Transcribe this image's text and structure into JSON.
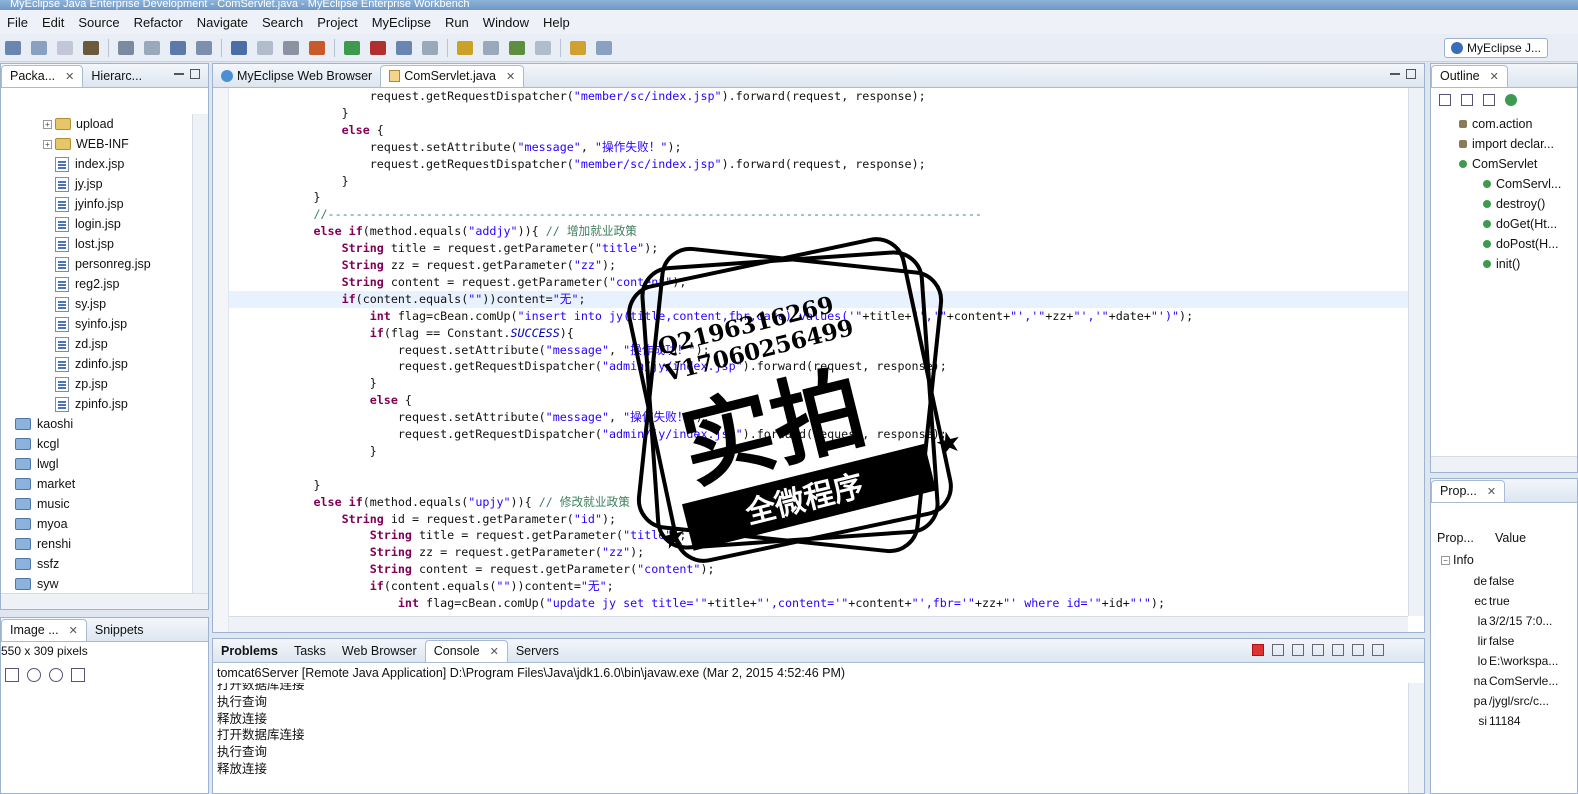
{
  "window": {
    "title": "MyEclipse Java Enterprise Development - ComServlet.java - MyEclipse Enterprise Workbench"
  },
  "menu": [
    "File",
    "Edit",
    "Source",
    "Refactor",
    "Navigate",
    "Search",
    "Project",
    "MyEclipse",
    "Run",
    "Window",
    "Help"
  ],
  "perspective": "MyEclipse J...",
  "left_panel": {
    "tabs": [
      "Packa...",
      "Hierarc..."
    ],
    "tree": [
      {
        "label": "upload",
        "type": "folder",
        "depth": 2,
        "expander": "+"
      },
      {
        "label": "WEB-INF",
        "type": "folder",
        "depth": 2,
        "expander": "+"
      },
      {
        "label": "index.jsp",
        "type": "jsp",
        "depth": 2
      },
      {
        "label": "jy.jsp",
        "type": "jsp",
        "depth": 2
      },
      {
        "label": "jyinfo.jsp",
        "type": "jsp",
        "depth": 2
      },
      {
        "label": "login.jsp",
        "type": "jsp",
        "depth": 2
      },
      {
        "label": "lost.jsp",
        "type": "jsp",
        "depth": 2
      },
      {
        "label": "personreg.jsp",
        "type": "jsp",
        "depth": 2
      },
      {
        "label": "reg2.jsp",
        "type": "jsp",
        "depth": 2
      },
      {
        "label": "sy.jsp",
        "type": "jsp",
        "depth": 2
      },
      {
        "label": "syinfo.jsp",
        "type": "jsp",
        "depth": 2
      },
      {
        "label": "zd.jsp",
        "type": "jsp",
        "depth": 2
      },
      {
        "label": "zdinfo.jsp",
        "type": "jsp",
        "depth": 2
      },
      {
        "label": "zp.jsp",
        "type": "jsp",
        "depth": 2
      },
      {
        "label": "zpinfo.jsp",
        "type": "jsp",
        "depth": 2
      },
      {
        "label": "kaoshi",
        "type": "proj",
        "depth": 1
      },
      {
        "label": "kcgl",
        "type": "proj",
        "depth": 1
      },
      {
        "label": "lwgl",
        "type": "proj",
        "depth": 1
      },
      {
        "label": "market",
        "type": "proj",
        "depth": 1
      },
      {
        "label": "music",
        "type": "proj",
        "depth": 1
      },
      {
        "label": "myoa",
        "type": "proj",
        "depth": 1
      },
      {
        "label": "renshi",
        "type": "proj",
        "depth": 1
      },
      {
        "label": "ssfz",
        "type": "proj",
        "depth": 1
      },
      {
        "label": "syw",
        "type": "proj",
        "depth": 1
      }
    ]
  },
  "image_panel": {
    "tabs": [
      "Image ...",
      "Snippets"
    ],
    "size_text": "550 x 309 pixels"
  },
  "editor": {
    "tabs": [
      "MyEclipse Web Browser",
      "ComServlet.java"
    ],
    "lines": [
      "                    request.getRequestDispatcher(\"member/sc/index.jsp\").forward(request, response);",
      "                }",
      "                else {",
      "                    request.setAttribute(\"message\", \"操作失败！\");",
      "                    request.getRequestDispatcher(\"member/sc/index.jsp\").forward(request, response);",
      "                }",
      "            }",
      "            //---------------------------------------------------------------------------------------------",
      "            else if(method.equals(\"addjy\")){ // 增加就业政策",
      "                String title = request.getParameter(\"title\");",
      "                String zz = request.getParameter(\"zz\");",
      "                String content = request.getParameter(\"content\");",
      "                if(content.equals(\"\"))content=\"无\";",
      "                    int flag=cBean.comUp(\"insert into jy(title,content,fbr,date) values('\"+title+\"','\"+content+\"','\"+zz+\"','\"+date+\"')\");",
      "                    if(flag == Constant.SUCCESS){",
      "                        request.setAttribute(\"message\", \"操作成功！\");",
      "                        request.getRequestDispatcher(\"admin/jy/index.jsp\").forward(request, response);",
      "                    }",
      "                    else {",
      "                        request.setAttribute(\"message\", \"操作失败！\");",
      "                        request.getRequestDispatcher(\"admin/jy/index.jsp\").forward(request, response);",
      "                    }",
      "",
      "            }",
      "            else if(method.equals(\"upjy\")){ // 修改就业政策",
      "                String id = request.getParameter(\"id\");",
      "                    String title = request.getParameter(\"title\");",
      "                    String zz = request.getParameter(\"zz\");",
      "                    String content = request.getParameter(\"content\");",
      "                    if(content.equals(\"\"))content=\"无\";",
      "                        int flag=cBean.comUp(\"update jy set title='\"+title+\"',content='\"+content+\"',fbr='\"+zz+\"' where id='\"+id+\"'\");"
    ]
  },
  "outline": {
    "tab": "Outline",
    "items": [
      {
        "label": "com.action",
        "depth": 0
      },
      {
        "label": "import declar...",
        "depth": 0
      },
      {
        "label": "ComServlet",
        "depth": 0
      },
      {
        "label": "ComServl...",
        "depth": 1
      },
      {
        "label": "destroy()",
        "depth": 1
      },
      {
        "label": "doGet(Ht...",
        "depth": 1
      },
      {
        "label": "doPost(H...",
        "depth": 1
      },
      {
        "label": "init()",
        "depth": 1
      }
    ]
  },
  "properties": {
    "tab": "Prop...",
    "col_property": "Prop...",
    "col_value": "Value",
    "group": "Info",
    "rows": [
      {
        "k": "de",
        "v": "false"
      },
      {
        "k": "ec",
        "v": "true"
      },
      {
        "k": "la",
        "v": "3/2/15 7:0..."
      },
      {
        "k": "lir",
        "v": "false"
      },
      {
        "k": "lo",
        "v": "E:\\workspa..."
      },
      {
        "k": "na",
        "v": "ComServle..."
      },
      {
        "k": "pa",
        "v": "/jygl/src/c..."
      },
      {
        "k": "si",
        "v": "11184"
      }
    ]
  },
  "bottom": {
    "tabs": [
      "Problems",
      "Tasks",
      "Web Browser",
      "Console",
      "Servers"
    ],
    "header": "tomcat6Server [Remote Java Application] D:\\Program Files\\Java\\jdk1.6.0\\bin\\javaw.exe (Mar 2, 2015 4:52:46 PM)",
    "lines": [
      "打开数据库连接",
      "执行查询",
      "释放连接",
      "打开数据库连接",
      "执行查询",
      "释放连接"
    ]
  },
  "watermark": {
    "qq": "Q2196316269",
    "v": "V17060256499",
    "big": "实拍",
    "banner": "全微程序"
  },
  "colors": {
    "keyword": "#7f0055",
    "string": "#2a00ff",
    "comment": "#3f7f5f",
    "accent": "#9eb3cf"
  }
}
